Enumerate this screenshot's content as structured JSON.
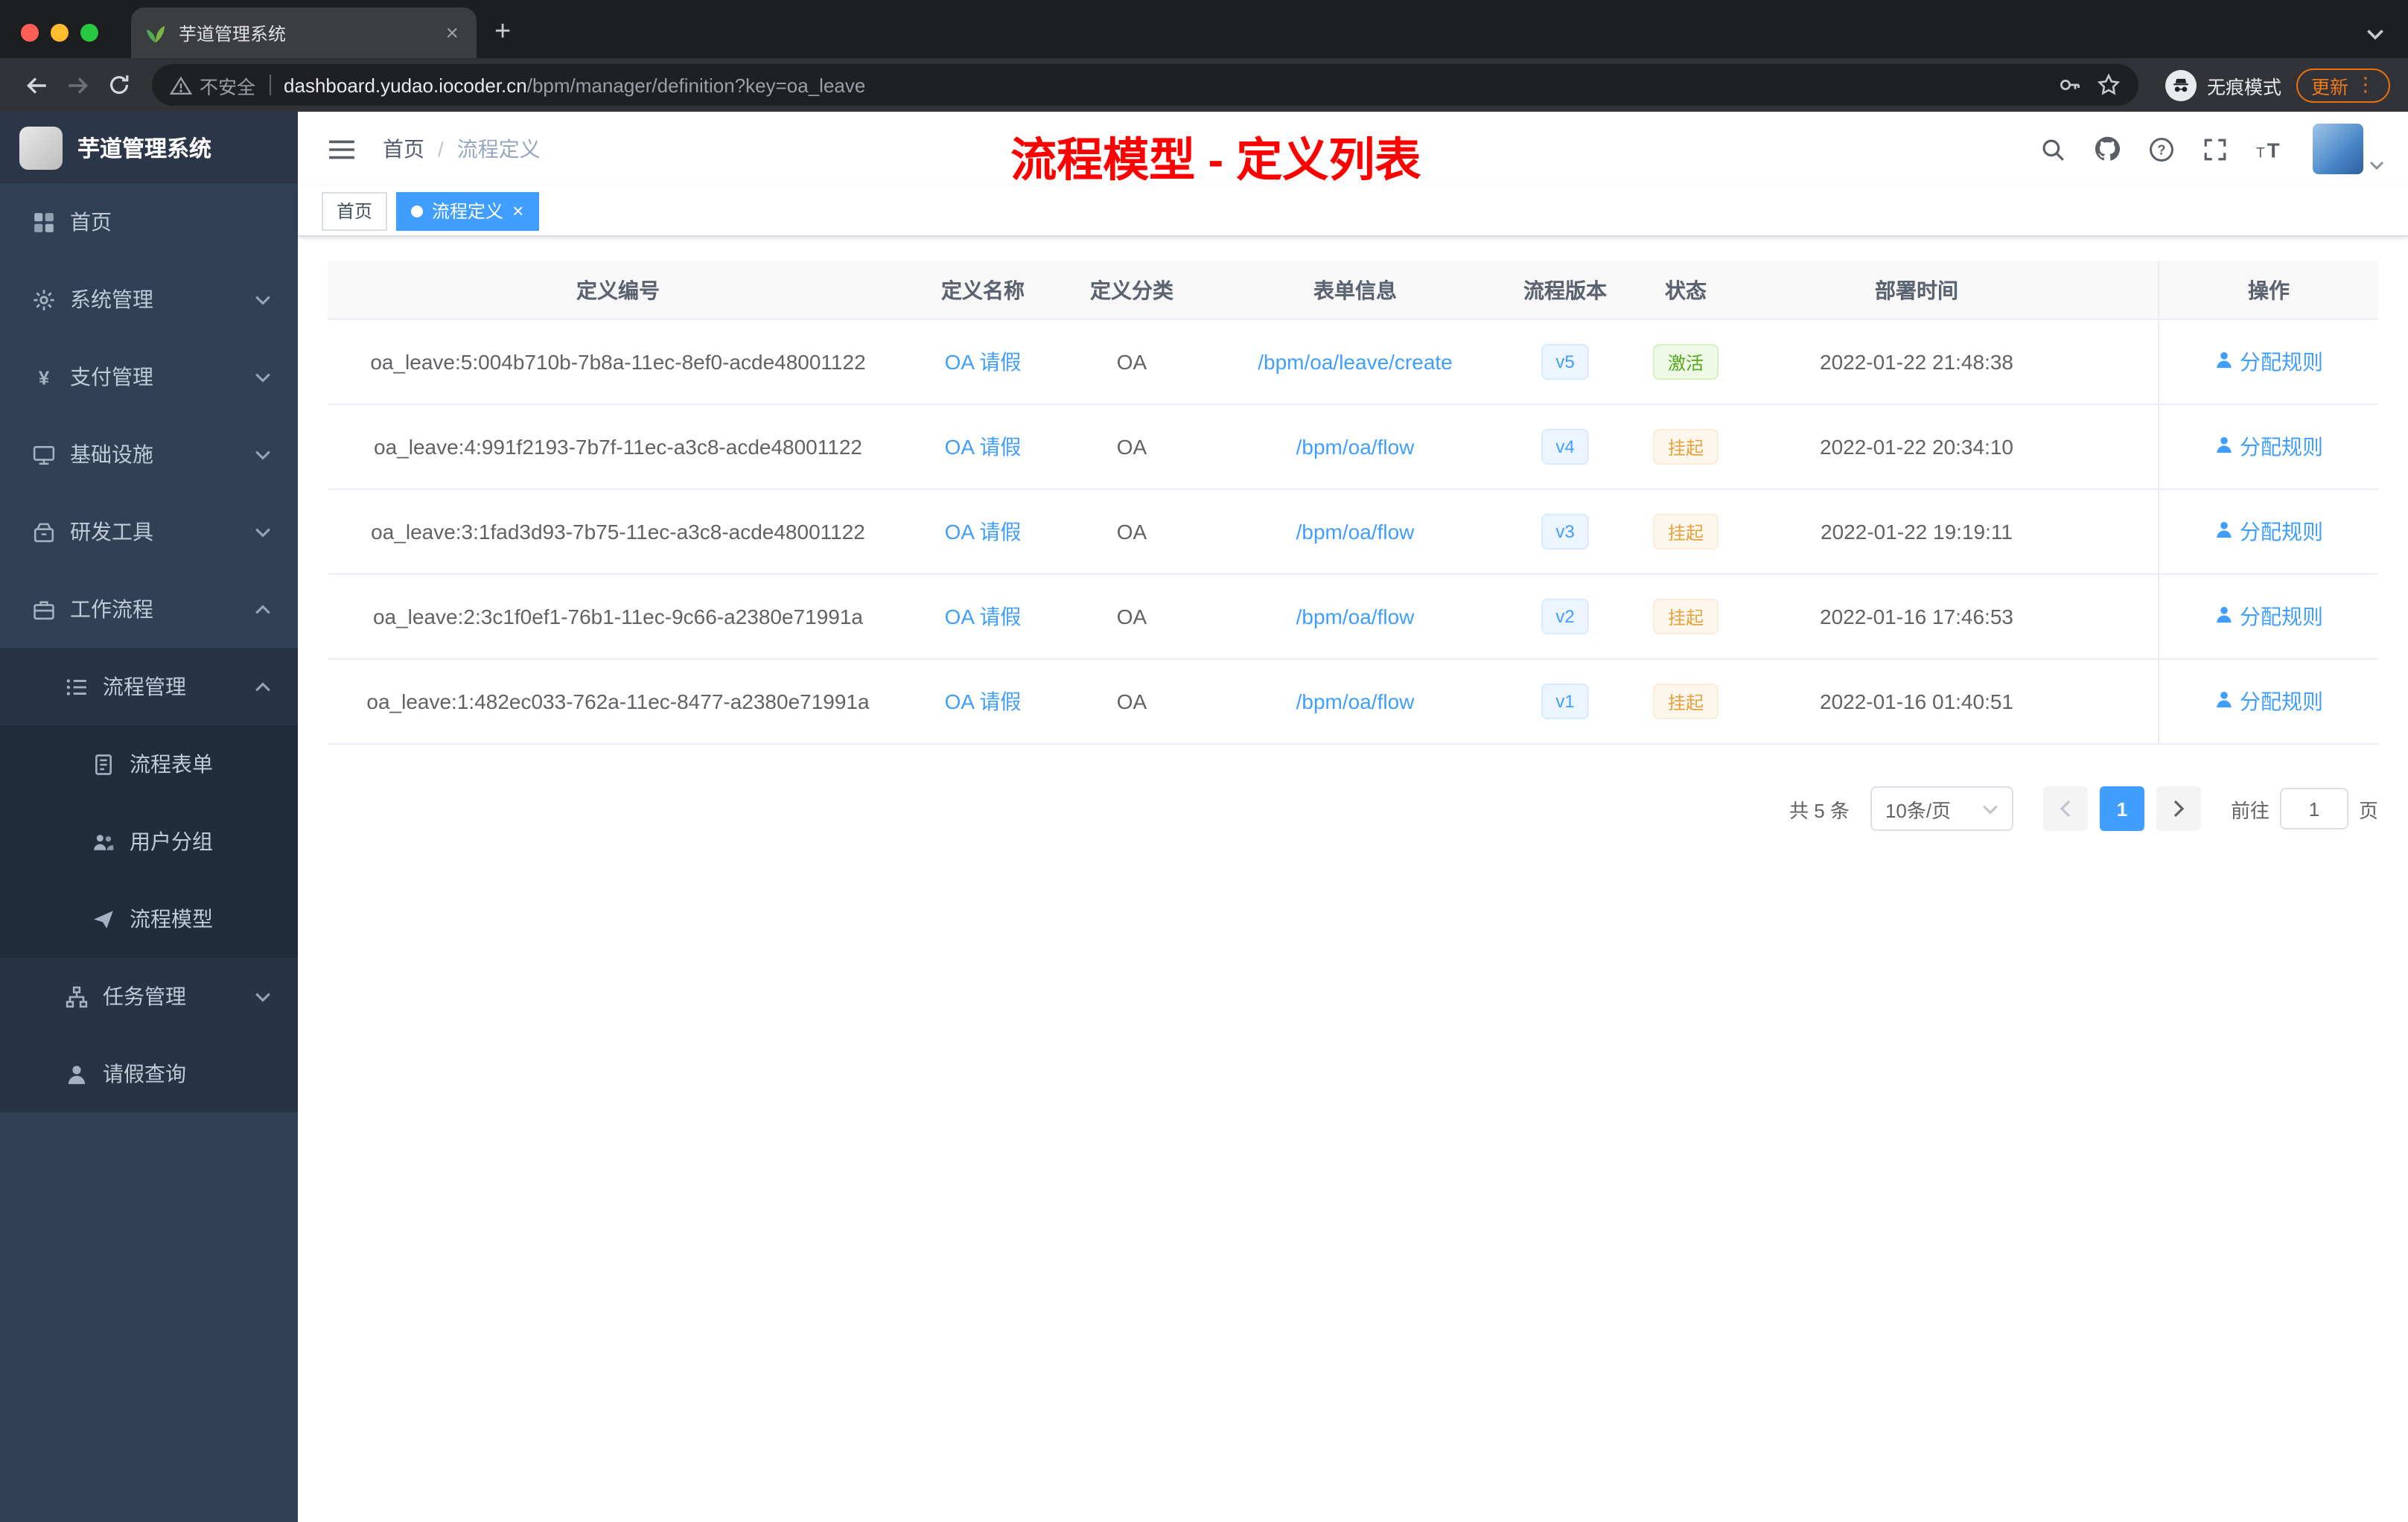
{
  "browser": {
    "tab": {
      "title": "芋道管理系统"
    },
    "toolbar": {
      "not_secure_label": "不安全",
      "url_host": "dashboard.yudao.iocoder.cn",
      "url_path": "/bpm/manager/definition?key=oa_leave",
      "incognito_label": "无痕模式",
      "update_label": "更新"
    }
  },
  "sidebar": {
    "logo_title": "芋道管理系统",
    "menu": [
      {
        "label": "首页",
        "level": 1,
        "icon": "dashboard-icon",
        "arrow": null
      },
      {
        "label": "系统管理",
        "level": 1,
        "icon": "gear-icon",
        "arrow": "down"
      },
      {
        "label": "支付管理",
        "level": 1,
        "icon": "yen-icon",
        "arrow": "down"
      },
      {
        "label": "基础设施",
        "level": 1,
        "icon": "infrastructure-icon",
        "arrow": "down"
      },
      {
        "label": "研发工具",
        "level": 1,
        "icon": "devtools-icon",
        "arrow": "down"
      },
      {
        "label": "工作流程",
        "level": 1,
        "icon": "workflow-icon",
        "arrow": "up"
      },
      {
        "label": "流程管理",
        "level": 2,
        "icon": "list-icon",
        "arrow": "up"
      },
      {
        "label": "流程表单",
        "level": 3,
        "icon": "form-icon",
        "arrow": null
      },
      {
        "label": "用户分组",
        "level": 3,
        "icon": "user-group-icon",
        "arrow": null
      },
      {
        "label": "流程模型",
        "level": 3,
        "icon": "paper-plane-icon",
        "arrow": null
      },
      {
        "label": "任务管理",
        "level": 2,
        "icon": "task-icon",
        "arrow": "down"
      },
      {
        "label": "请假查询",
        "level": 2,
        "icon": "user-icon",
        "arrow": null
      }
    ]
  },
  "navbar": {
    "breadcrumb": {
      "home": "首页",
      "separator": "/",
      "current": "流程定义"
    },
    "annotation": "流程模型 - 定义列表"
  },
  "tags": [
    {
      "label": "首页",
      "active": false,
      "closable": false
    },
    {
      "label": "流程定义",
      "active": true,
      "closable": true
    }
  ],
  "table": {
    "headers": [
      "定义编号",
      "定义名称",
      "定义分类",
      "表单信息",
      "流程版本",
      "状态",
      "部署时间",
      "操作"
    ],
    "rows": [
      {
        "id": "oa_leave:5:004b710b-7b8a-11ec-8ef0-acde48001122",
        "name": "OA 请假",
        "category": "OA",
        "form": "/bpm/oa/leave/create",
        "version": "v5",
        "status": "激活",
        "status_type": "success",
        "deploy_time": "2022-01-22 21:48:38",
        "action": "分配规则"
      },
      {
        "id": "oa_leave:4:991f2193-7b7f-11ec-a3c8-acde48001122",
        "name": "OA 请假",
        "category": "OA",
        "form": "/bpm/oa/flow",
        "version": "v4",
        "status": "挂起",
        "status_type": "warning",
        "deploy_time": "2022-01-22 20:34:10",
        "action": "分配规则"
      },
      {
        "id": "oa_leave:3:1fad3d93-7b75-11ec-a3c8-acde48001122",
        "name": "OA 请假",
        "category": "OA",
        "form": "/bpm/oa/flow",
        "version": "v3",
        "status": "挂起",
        "status_type": "warning",
        "deploy_time": "2022-01-22 19:19:11",
        "action": "分配规则"
      },
      {
        "id": "oa_leave:2:3c1f0ef1-76b1-11ec-9c66-a2380e71991a",
        "name": "OA 请假",
        "category": "OA",
        "form": "/bpm/oa/flow",
        "version": "v2",
        "status": "挂起",
        "status_type": "warning",
        "deploy_time": "2022-01-16 17:46:53",
        "action": "分配规则"
      },
      {
        "id": "oa_leave:1:482ec033-762a-11ec-8477-a2380e71991a",
        "name": "OA 请假",
        "category": "OA",
        "form": "/bpm/oa/flow",
        "version": "v1",
        "status": "挂起",
        "status_type": "warning",
        "deploy_time": "2022-01-16 01:40:51",
        "action": "分配规则"
      }
    ]
  },
  "pagination": {
    "total_label": "共 5 条",
    "page_size": "10条/页",
    "current_page": "1",
    "goto_label": "前往",
    "goto_value": "1",
    "page_unit": "页"
  }
}
